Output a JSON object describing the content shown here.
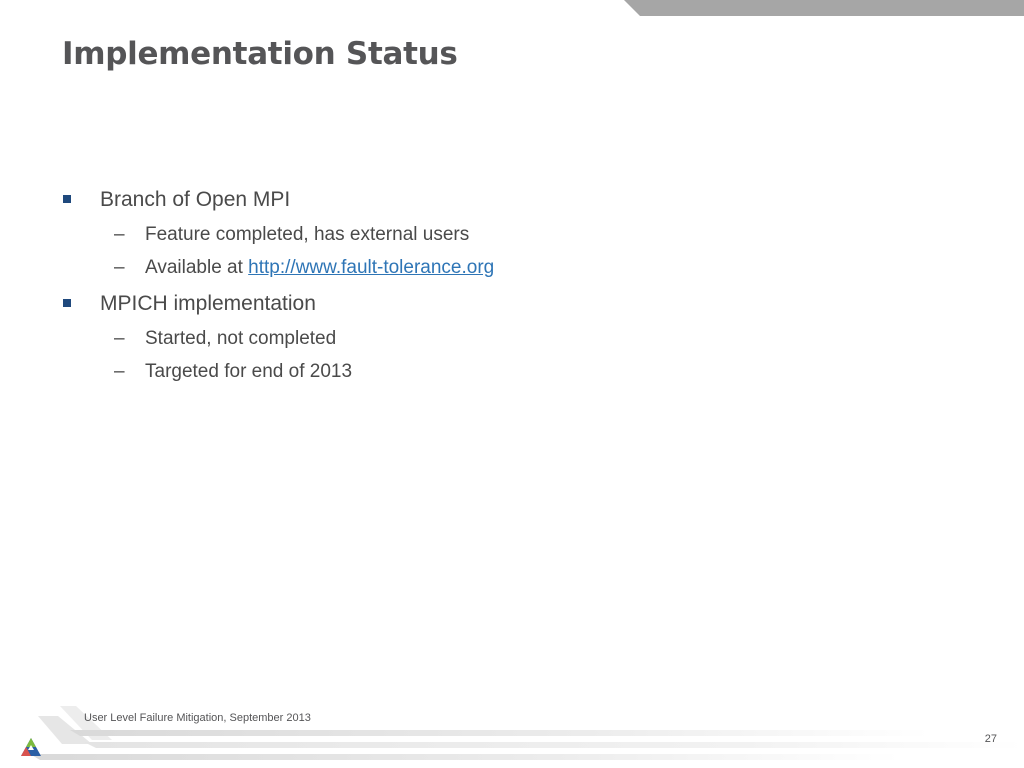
{
  "slide": {
    "title": "Implementation Status"
  },
  "bullets": [
    {
      "text": "Branch of Open MPI",
      "sub": [
        {
          "text": "Feature completed, has external users"
        },
        {
          "prefix": "Available at ",
          "link_text": "http://www.fault-tolerance.org"
        }
      ]
    },
    {
      "text": "MPICH implementation",
      "sub": [
        {
          "text": "Started, not completed"
        },
        {
          "text": "Targeted for end of 2013"
        }
      ]
    }
  ],
  "dash_symbol": "–",
  "footer": {
    "caption": "User Level Failure Mitigation, September 2013",
    "page_number": "27"
  },
  "colors": {
    "title": "#555557",
    "bullet_square": "#1f497d",
    "link": "#2e75b6",
    "band_gray": "#a6a6a6"
  },
  "icons": {
    "bullet": "square-bullet-icon",
    "logo": "triangle-logo-icon"
  }
}
